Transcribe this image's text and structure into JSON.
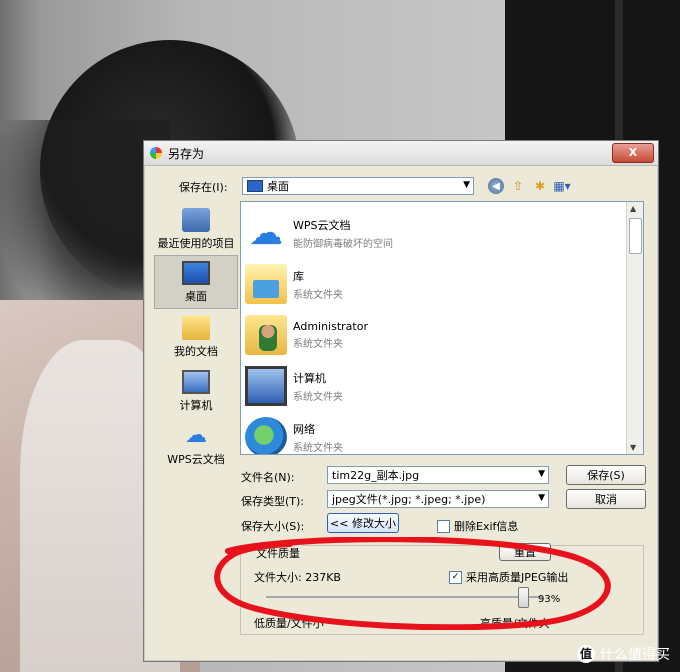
{
  "dialog": {
    "title": "另存为",
    "close_label": "X"
  },
  "savein": {
    "label": "保存在(I):",
    "value": "桌面"
  },
  "places": [
    {
      "label": "最近使用的项目",
      "icon": "recent-items-icon"
    },
    {
      "label": "桌面",
      "icon": "desktop-icon",
      "selected": true
    },
    {
      "label": "我的文档",
      "icon": "my-documents-icon"
    },
    {
      "label": "计算机",
      "icon": "computer-icon"
    },
    {
      "label": "WPS云文档",
      "icon": "wps-cloud-icon"
    }
  ],
  "files": [
    {
      "name": "WPS云文档",
      "sub": "能防御病毒破坏的空间",
      "icon": "wps-cloud-icon"
    },
    {
      "name": "库",
      "sub": "系统文件夹",
      "icon": "library-folder-icon"
    },
    {
      "name": "Administrator",
      "sub": "系统文件夹",
      "icon": "user-folder-icon"
    },
    {
      "name": "计算机",
      "sub": "系统文件夹",
      "icon": "computer-icon"
    },
    {
      "name": "网络",
      "sub": "系统文件夹",
      "icon": "network-icon"
    }
  ],
  "filename": {
    "label": "文件名(N):",
    "value": "tim22g_副本.jpg"
  },
  "filetype": {
    "label": "保存类型(T):",
    "value": "jpeg文件(*.jpg; *.jpeg; *.jpe)"
  },
  "filesize": {
    "label": "保存大小(S):",
    "button": "<< 修改大小"
  },
  "buttons": {
    "save": "保存(S)",
    "cancel": "取消",
    "reset": "重置"
  },
  "exif": {
    "label": "删除Exif信息",
    "checked": false
  },
  "quality": {
    "title": "文件质量",
    "size_label": "文件大小: 237KB",
    "hq_label": "采用高质量JPEG输出",
    "hq_checked": true,
    "percent": "93%",
    "value": 0.93,
    "low_label": "低质量/文件小",
    "high_label": "高质量/文件大"
  },
  "watermark": {
    "badge": "值",
    "text": "什么值得买"
  },
  "colors": {
    "annotation": "#e8121c",
    "dialog_bg": "#ece9d8"
  }
}
